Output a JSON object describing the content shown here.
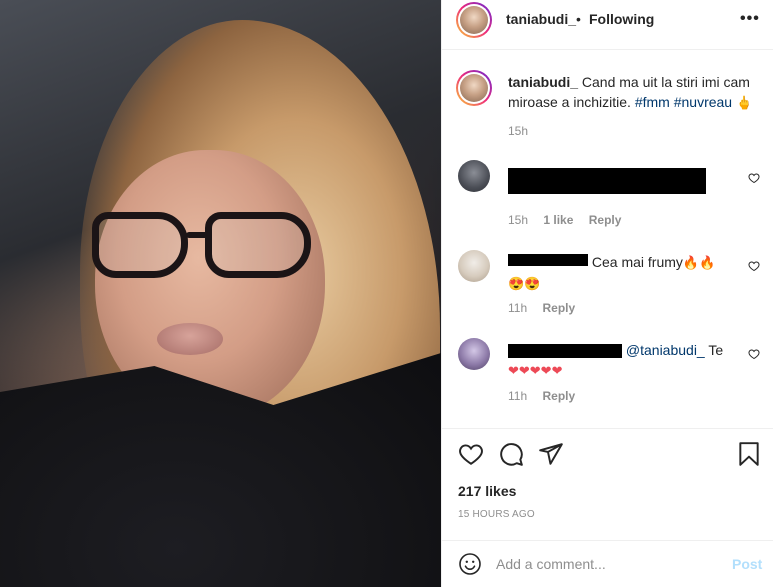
{
  "header": {
    "username": "taniabudi_",
    "dot": "•",
    "follow_status": "Following",
    "more": "•••"
  },
  "caption": {
    "username": "taniabudi_",
    "text": "Cand ma uit la stiri imi cam miroase a inchizitie.",
    "hashtags": [
      "#fmm",
      "#nuvreau"
    ],
    "emoji": "🖕",
    "time": "15h"
  },
  "comments": [
    {
      "username_redacted": true,
      "text_redacted": true,
      "time": "15h",
      "likes": "1 like",
      "reply": "Reply"
    },
    {
      "username_redacted": true,
      "text": "Cea mai frumy",
      "emojis": "🔥🔥",
      "emojis_line2": "😍😍",
      "time": "11h",
      "reply": "Reply"
    },
    {
      "username_redacted": true,
      "mention": "@taniabudi_",
      "text": "Te",
      "emojis_line2": "❤❤❤❤❤",
      "time": "11h",
      "reply": "Reply"
    }
  ],
  "stats": {
    "likes": "217 likes",
    "time_ago": "15 HOURS AGO"
  },
  "comment_box": {
    "placeholder": "Add a comment...",
    "post_label": "Post"
  },
  "icons": [
    "heart-icon",
    "comment-icon",
    "share-icon",
    "bookmark-icon",
    "emoji-icon",
    "more-icon"
  ],
  "colors": {
    "link": "#00376b",
    "muted": "#8e8e8e",
    "text": "#262626",
    "post_disabled": "#b2dffc",
    "like_red": "#ed4956"
  }
}
